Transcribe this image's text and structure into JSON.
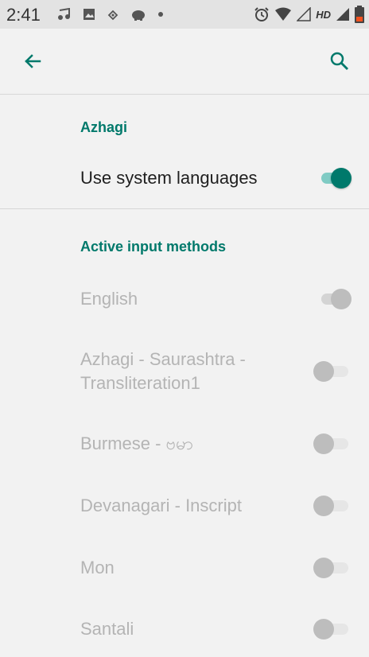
{
  "status_bar": {
    "time": "2:41",
    "hd_label": "HD"
  },
  "toolbar": {
    "back_icon": "arrow-back-icon",
    "search_icon": "search-icon"
  },
  "colors": {
    "accent": "#00796b",
    "accent_light": "#80cbc4",
    "disabled_text": "#b4b4b4"
  },
  "header_section": {
    "title": "Azhagi",
    "use_system_languages": {
      "label": "Use system languages",
      "checked": true
    }
  },
  "active_input_methods": {
    "title": "Active input methods",
    "items": [
      {
        "label": "English",
        "checked": true,
        "enabled": false
      },
      {
        "label_line1": "Azhagi - Saurashtra -",
        "label_line2": "Transliteration1",
        "checked": false,
        "enabled": false
      },
      {
        "label": "Burmese - ဗမာ",
        "checked": false,
        "enabled": false
      },
      {
        "label": "Devanagari - Inscript",
        "checked": false,
        "enabled": false
      },
      {
        "label": "Mon",
        "checked": false,
        "enabled": false
      },
      {
        "label": "Santali",
        "checked": false,
        "enabled": false
      }
    ]
  }
}
